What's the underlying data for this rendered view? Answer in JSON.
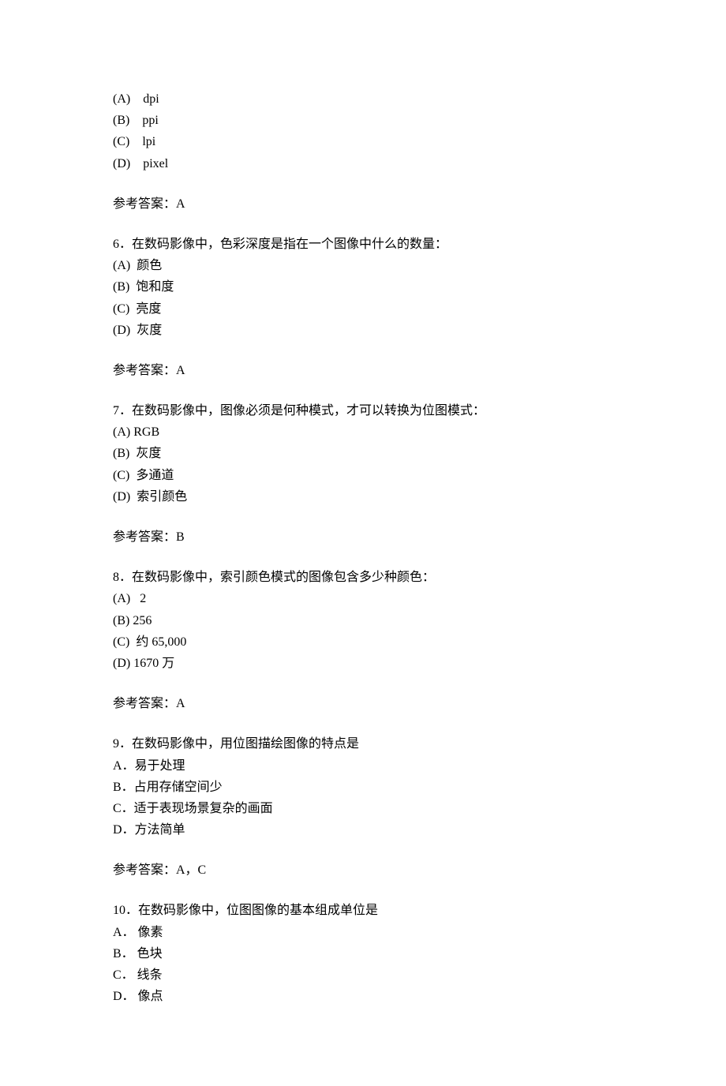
{
  "q5_partial": {
    "options": [
      "(A)    dpi",
      "(B)    ppi",
      "(C)    lpi",
      "(D)    pixel"
    ],
    "answer": "参考答案：A"
  },
  "q6": {
    "stem": "6．在数码影像中，色彩深度是指在一个图像中什么的数量：",
    "options": [
      "(A)  颜色",
      "(B)  饱和度",
      "(C)  亮度",
      "(D)  灰度"
    ],
    "answer": "参考答案：A"
  },
  "q7": {
    "stem": "7．在数码影像中，图像必须是何种模式，才可以转换为位图模式：",
    "options": [
      "(A) RGB",
      "(B)  灰度",
      "(C)  多通道",
      "(D)  索引颜色"
    ],
    "answer": "参考答案：B"
  },
  "q8": {
    "stem": "8．在数码影像中，索引颜色模式的图像包含多少种颜色：",
    "options": [
      "(A)   2",
      "(B) 256",
      "(C)  约 65,000",
      "(D) 1670 万"
    ],
    "answer": "参考答案：A"
  },
  "q9": {
    "stem": "9．在数码影像中，用位图描绘图像的特点是",
    "options": [
      "A．易于处理",
      "B．占用存储空间少",
      "C．适于表现场景复杂的画面",
      "D．方法简单"
    ],
    "answer": "参考答案：A，C"
  },
  "q10": {
    "stem": "10．在数码影像中，位图图像的基本组成单位是",
    "options": [
      "A． 像素",
      "B． 色块",
      "C． 线条",
      "D． 像点"
    ]
  }
}
